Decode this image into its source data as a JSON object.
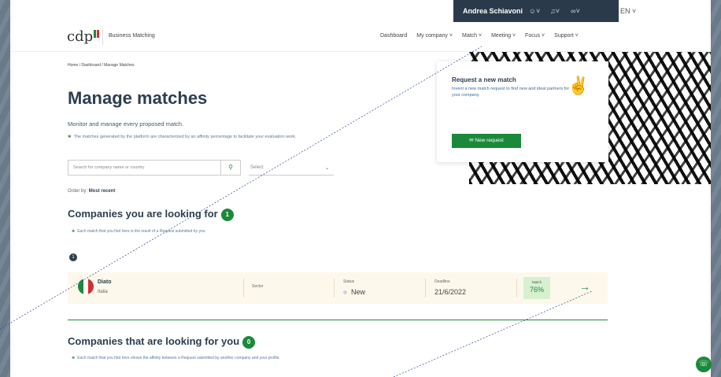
{
  "topbar": {
    "user_name": "Andrea Schiavoni",
    "icons": [
      "user-icon",
      "bell-icon",
      "connections-icon"
    ],
    "language": "EN"
  },
  "header": {
    "logo_text": "cdp",
    "brand": "Business Matching",
    "nav": [
      "Dashboard",
      "My company",
      "Match",
      "Meeting",
      "Focus",
      "Support"
    ]
  },
  "breadcrumb": "Home / Dashboard / Manage Matches",
  "page": {
    "title": "Manage matches",
    "subtitle": "Monitor and manage every proposed match.",
    "note": "The matches generated by the platform are characterized by an affinity percentage to facilitate your evaluation work."
  },
  "filters": {
    "search_placeholder": "Search for company name or country",
    "select_placeholder": "Select",
    "order_label": "Order by:",
    "order_value": "Most recent"
  },
  "looking_for": {
    "title": "Companies you are looking for",
    "count": "1",
    "note": "Each match that you find here is the result of a Request submitted by you",
    "page": "1",
    "rows": [
      {
        "company": "Diato",
        "country": "Italia",
        "sector_label": "Sector",
        "status_label": "Status",
        "status": "New",
        "deadline_label": "Deadline",
        "deadline": "21/6/2022",
        "match_label": "Match",
        "match": "76%"
      }
    ]
  },
  "looking_for_you": {
    "title": "Companies that are looking for you",
    "count": "0",
    "note": "Each match that you find here shows the affinity between a Request submitted by another company and your profile."
  },
  "request_card": {
    "title": "Request a new match",
    "description": "Invent a new match request to find new and ideal partners for your company.",
    "button": "New request"
  },
  "colors": {
    "accent": "#1a8a3a",
    "dark": "#2b3a4a",
    "row_bg": "#fdf8ec",
    "match_bg": "#d6f0d0"
  }
}
